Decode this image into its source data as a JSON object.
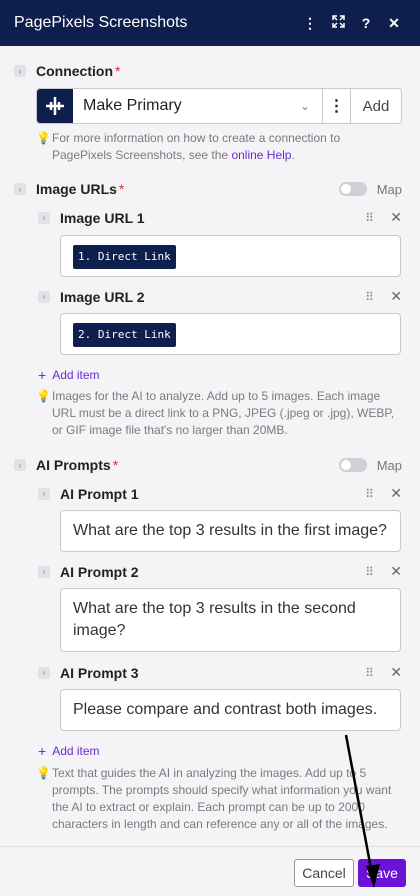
{
  "header": {
    "title": "PagePixels Screenshots",
    "menu_icon": "more-vertical-icon",
    "expand_icon": "expand-icon",
    "help_label": "?",
    "close_label": "✕"
  },
  "connection": {
    "label": "Connection",
    "required_mark": "*",
    "selected": "Make Primary",
    "add_label": "Add",
    "hint_prefix": "For more information on how to create a connection to PagePixels Screenshots, see the ",
    "hint_link": "online Help",
    "hint_suffix": "."
  },
  "image_urls": {
    "label": "Image URLs",
    "required_mark": "*",
    "map_label": "Map",
    "items": [
      {
        "label": "Image URL 1",
        "value": "1. Direct Link"
      },
      {
        "label": "Image URL 2",
        "value": "2. Direct Link"
      }
    ],
    "add_item_label": "Add item",
    "hint": "Images for the AI to analyze. Add up to 5 images. Each image URL must be a direct link to a PNG, JPEG (.jpeg or .jpg), WEBP, or GIF image file that's no larger than 20MB."
  },
  "ai_prompts": {
    "label": "AI Prompts",
    "required_mark": "*",
    "map_label": "Map",
    "items": [
      {
        "label": "AI Prompt 1",
        "value": "What are the top 3 results in the first image?"
      },
      {
        "label": "AI Prompt 2",
        "value": "What are the top 3 results in the second image?"
      },
      {
        "label": "AI Prompt 3",
        "value": "Please compare and contrast both images."
      }
    ],
    "add_item_label": "Add item",
    "hint": "Text that guides the AI in analyzing the images. Add up to 5 prompts. The prompts should specify what information you want the AI to extract or explain. Each prompt can be up to 2000 characters in length and can reference any or all of the images."
  },
  "footer": {
    "cancel_label": "Cancel",
    "save_label": "Save"
  },
  "colors": {
    "header_bg": "#0f1f4d",
    "accent": "#6a12d6",
    "required": "#d0322c"
  }
}
